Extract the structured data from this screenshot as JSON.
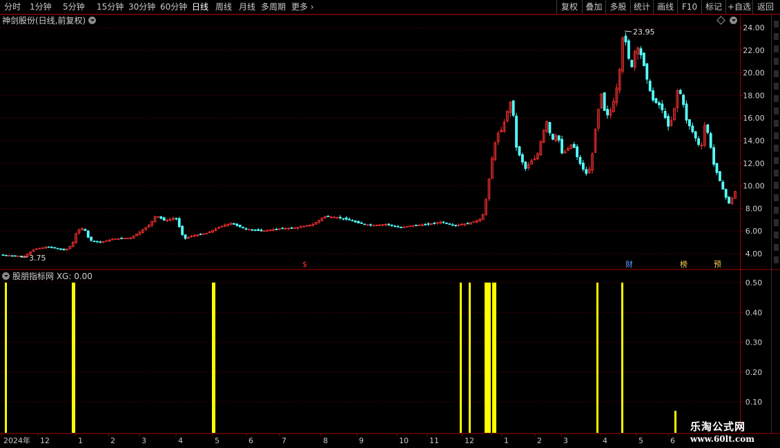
{
  "toolbar": {
    "periods": [
      {
        "label": "分时",
        "active": false
      },
      {
        "label": "1分钟",
        "active": false
      },
      {
        "label": "5分钟",
        "active": false
      },
      {
        "label": "15分钟",
        "active": false
      },
      {
        "label": "30分钟",
        "active": false
      },
      {
        "label": "60分钟",
        "active": false
      },
      {
        "label": "日线",
        "active": true
      },
      {
        "label": "周线",
        "active": false
      },
      {
        "label": "月线",
        "active": false
      },
      {
        "label": "多周期",
        "active": false
      },
      {
        "label": "更多",
        "active": false
      }
    ],
    "right_buttons": [
      "复权",
      "叠加",
      "多股",
      "统计",
      "画线",
      "F10",
      "标记",
      "+自选",
      "返回"
    ]
  },
  "chart_title": "神剑股份(日线,前复权)",
  "indicator_title": "股朋指标网 XG: 0.00",
  "price_axis": {
    "ticks": [
      "24.00",
      "22.00",
      "20.00",
      "18.00",
      "16.00",
      "14.00",
      "12.00",
      "10.00",
      "8.00",
      "6.00",
      "4.00"
    ]
  },
  "indicator_axis": {
    "ticks": [
      "0.50",
      "0.40",
      "0.30",
      "0.20",
      "0.10"
    ]
  },
  "annotations": {
    "high_label": "23.95",
    "low_label": "3.75",
    "markers": [
      {
        "text": "$",
        "color": "#ff3030"
      },
      {
        "text": "财",
        "color": "#5aa0ff"
      },
      {
        "text": "榜",
        "color": "#ffcc55"
      },
      {
        "text": "预",
        "color": "#ffcc55"
      }
    ]
  },
  "time_axis": {
    "labels": [
      "2024年",
      "12",
      "1",
      "2",
      "3",
      "4",
      "5",
      "6",
      "7",
      "8",
      "9",
      "10",
      "11",
      "12",
      "1",
      "2",
      "3",
      "4",
      "5",
      "6"
    ]
  },
  "watermark": {
    "line1": "乐淘公式网",
    "line2": "www.60lt.com"
  },
  "colors": {
    "up": "#ff3232",
    "down": "#54ffff",
    "signal": "#ffff00",
    "grid": "#7a0000",
    "axis": "#a00000"
  },
  "chart_data": {
    "type": "candlestick",
    "price_ylim": [
      3.0,
      25.0
    ],
    "key_prices": {
      "high": 23.95,
      "low": 3.75
    },
    "signal_values": [
      0.5,
      0.5,
      0.5,
      0.5,
      0.5,
      0.5,
      0.5,
      0.5,
      0.5,
      0.5,
      0.5,
      0.5,
      0.5,
      0.5,
      0.5,
      0.07
    ],
    "indicator_ylim": [
      0,
      0.55
    ]
  }
}
